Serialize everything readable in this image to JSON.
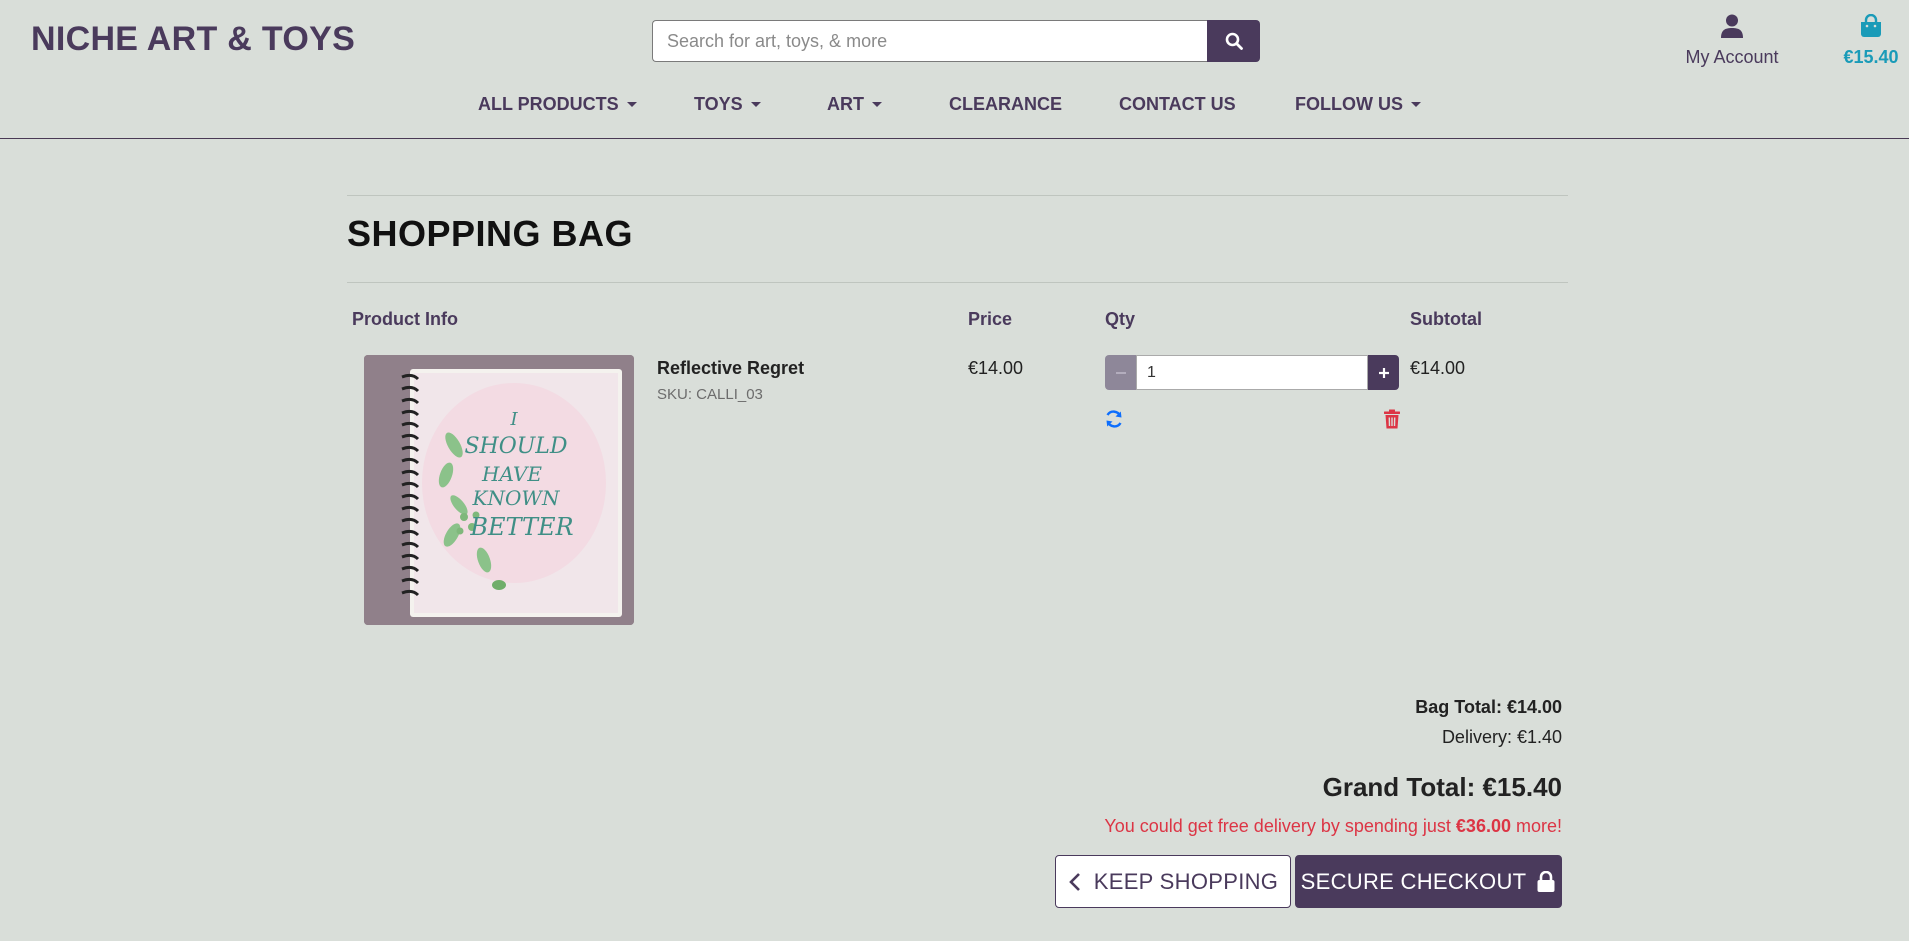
{
  "header": {
    "logo": "NICHE ART & TOYS",
    "search": {
      "placeholder": "Search for art, toys, & more",
      "value": ""
    },
    "account_label": "My Account",
    "bag_total": "€15.40"
  },
  "nav": {
    "items": [
      {
        "label": "ALL PRODUCTS",
        "dropdown": true
      },
      {
        "label": "TOYS",
        "dropdown": true
      },
      {
        "label": "ART",
        "dropdown": true
      },
      {
        "label": "CLEARANCE",
        "dropdown": false
      },
      {
        "label": "CONTACT US",
        "dropdown": false
      },
      {
        "label": "FOLLOW US",
        "dropdown": true
      }
    ]
  },
  "page": {
    "title": "SHOPPING BAG"
  },
  "table": {
    "headers": {
      "product_info": "Product Info",
      "price": "Price",
      "qty": "Qty",
      "subtotal": "Subtotal"
    },
    "rows": [
      {
        "name": "Reflective Regret",
        "sku": "SKU: CALLI_03",
        "price": "€14.00",
        "qty": "1",
        "subtotal": "€14.00",
        "image_text": [
          "I",
          "SHOULD",
          "HAVE",
          "KNOWN",
          "BETTER"
        ]
      }
    ]
  },
  "summary": {
    "bag_total": "Bag Total: €14.00",
    "delivery": "Delivery: €1.40",
    "grand_total": "Grand Total: €15.40",
    "free_delivery_prefix": "You could get free delivery by spending just ",
    "free_delivery_amount": "€36.00",
    "free_delivery_suffix": " more!"
  },
  "buttons": {
    "keep_shopping": "KEEP SHOPPING",
    "secure_checkout": "SECURE CHECKOUT"
  },
  "colors": {
    "brand": "#4a3a5c",
    "accent": "#1a9bb8",
    "danger": "#dc3545",
    "info": "#0d6efd",
    "background": "#d9ded9"
  }
}
